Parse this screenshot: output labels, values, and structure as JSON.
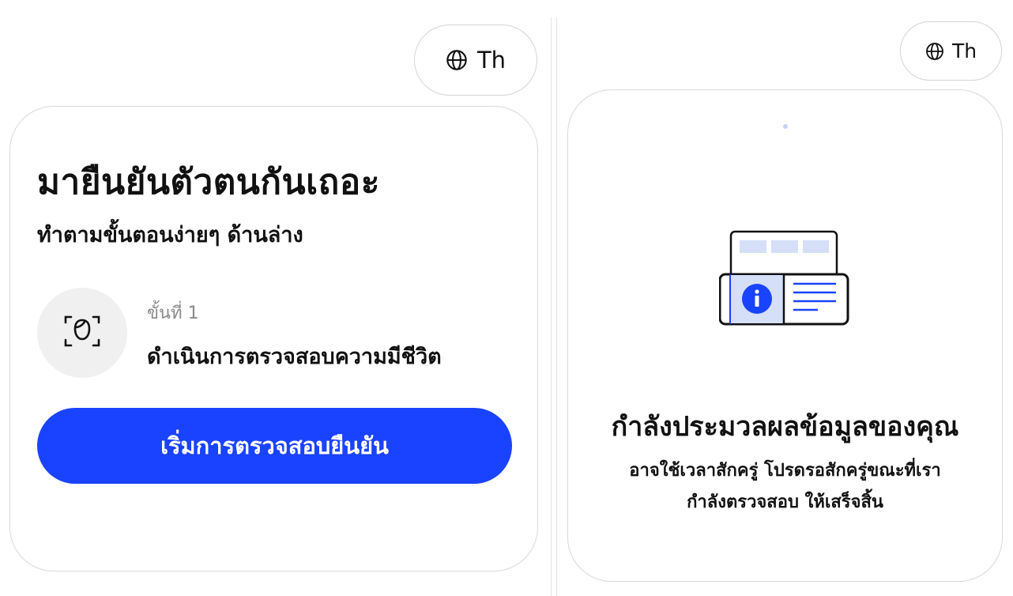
{
  "left_panel": {
    "language_button": {
      "label": "Th",
      "icon": "globe-icon"
    },
    "title": "มายืนยันตัวตนกันเถอะ",
    "subtitle": "ทำตามขั้นตอนง่ายๆ ด้านล่าง",
    "step": {
      "number_label": "ขั้นที่ 1",
      "label": "ดำเนินการตรวจสอบความมีชีวิต",
      "icon": "face-scan-icon"
    },
    "start_button_label": "เริ่มการตรวจสอบยืนยัน"
  },
  "right_panel": {
    "language_button": {
      "label": "Th",
      "icon": "globe-icon"
    },
    "illustration_icon": "id-card-scan-icon",
    "title": "กำลังประมวลผลข้อมูลของคุณ",
    "description_lines": [
      "อาจใช้เวลาสักครู่ โปรดรอสักครู่ขณะที่เรา",
      "กำลังตรวจสอบ ให้เสร็จสิ้น"
    ]
  },
  "colors": {
    "accent": "#1a43ff",
    "card_border": "#d9d9d9",
    "icon_bg": "#f0f0f0",
    "illustration_light": "#d6dff8",
    "illustration_blue": "#1a43ff"
  }
}
